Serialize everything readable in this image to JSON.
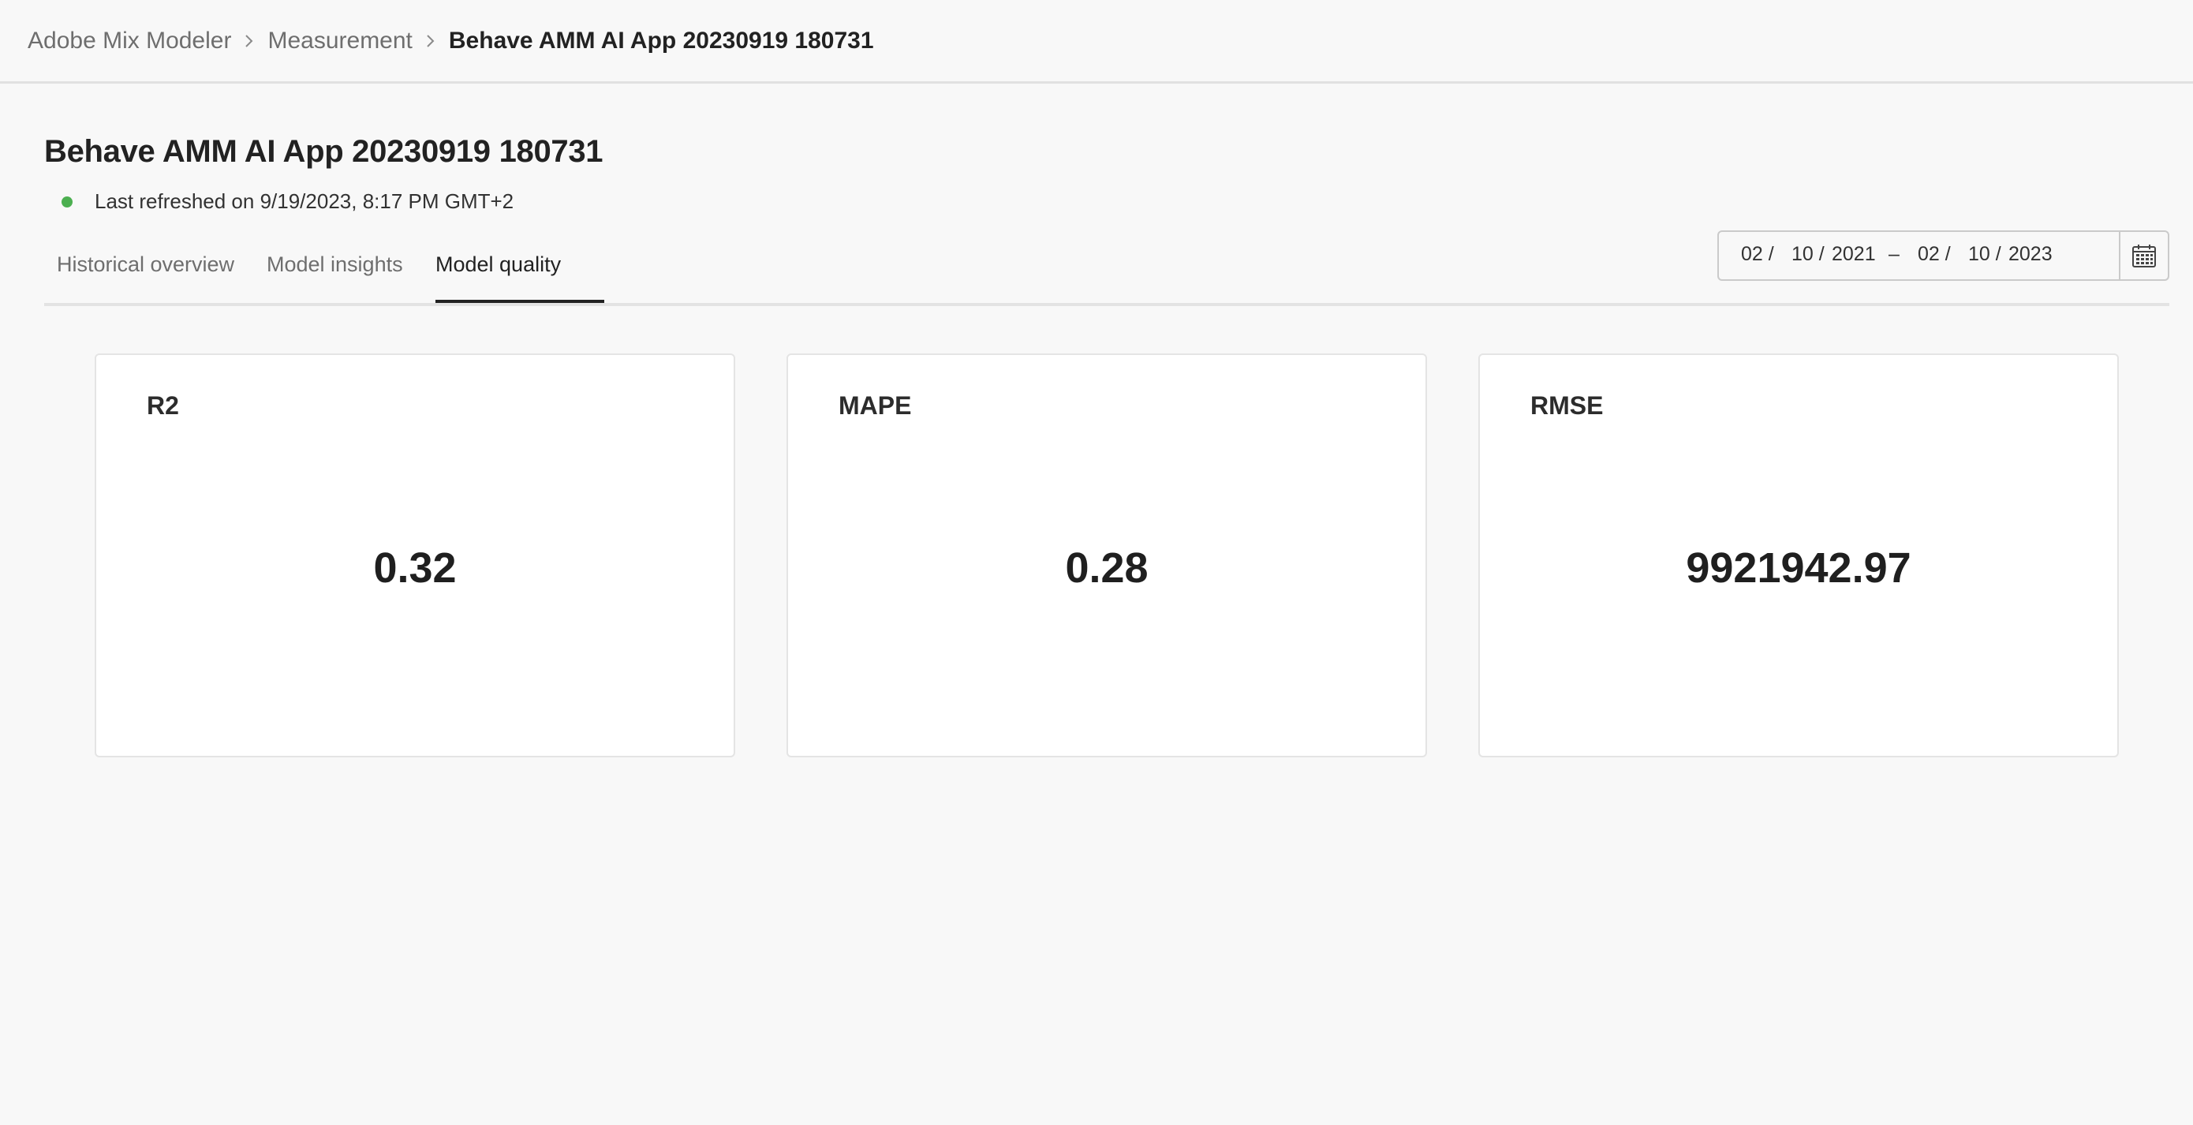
{
  "breadcrumb": {
    "items": [
      "Adobe Mix Modeler",
      "Measurement"
    ],
    "current": "Behave AMM AI App 20230919 180731"
  },
  "page": {
    "title": "Behave AMM AI App 20230919 180731",
    "status_text": "Last refreshed on 9/19/2023, 8:17 PM GMT+2",
    "status_color": "#4caf50"
  },
  "tabs": [
    {
      "label": "Historical overview",
      "active": false
    },
    {
      "label": "Model insights",
      "active": false
    },
    {
      "label": "Model quality",
      "active": true
    }
  ],
  "date_range": {
    "start_month": "02 /",
    "start_day": "10 /",
    "start_year": "2021",
    "separator": "–",
    "end_month": "02 /",
    "end_day": "10 /",
    "end_year": "2023",
    "icon": "calendar-icon"
  },
  "metrics": [
    {
      "label": "R2",
      "value": "0.32"
    },
    {
      "label": "MAPE",
      "value": "0.28"
    },
    {
      "label": "RMSE",
      "value": "9921942.97"
    }
  ]
}
